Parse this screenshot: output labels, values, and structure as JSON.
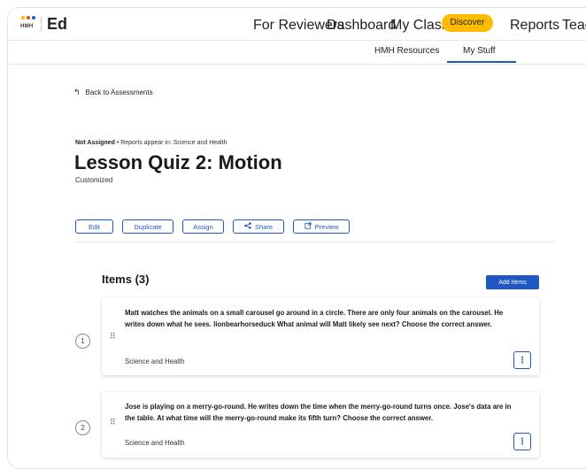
{
  "brand": {
    "logo_text": "HMH",
    "app_name": "Ed",
    "dot_colors": [
      "#ffbb00",
      "#e2442f",
      "#1f57c5"
    ]
  },
  "nav": {
    "items": [
      "For Reviewers",
      "Dashboard",
      "My Classes",
      "Discover",
      "Reports",
      "Teache"
    ],
    "active": "Discover",
    "active_color": "#ffbb00"
  },
  "subnav": {
    "items": [
      "HMH Resources",
      "My Stuff"
    ],
    "active": "My Stuff"
  },
  "back_link": "Back to Assessments",
  "assessment": {
    "status": "Not Assigned",
    "reports_note": "• Reports appear in: Science and Health",
    "title": "Lesson Quiz 2: Motion",
    "subtitle": "Customized"
  },
  "actions": {
    "edit": "Edit",
    "duplicate": "Duplicate",
    "assign": "Assign",
    "share": "Share",
    "preview": "Preview"
  },
  "items_section": {
    "heading": "Items (3)",
    "add_button": "Add Items",
    "items": [
      {
        "number": "1",
        "text": "Matt watches the animals on a small carousel go around in a circle. There are only four animals on the carousel. He writes down what he sees. lionbearhorseduck What animal will Matt likely see next? Choose the correct answer.",
        "subject": "Science and Health"
      },
      {
        "number": "2",
        "text": "Jose is playing on a merry-go-round. He writes down the time when the merry-go-round turns once. Jose's data are in the table. At what time will the merry-go-round make its fifth turn? Choose the correct answer.",
        "subject": "Science and Health"
      }
    ]
  },
  "icons": {
    "back": "back-arrow-icon",
    "share": "share-icon",
    "preview": "external-preview-icon",
    "drag": "drag-handle-icon",
    "more": "kebab-menu-icon"
  }
}
